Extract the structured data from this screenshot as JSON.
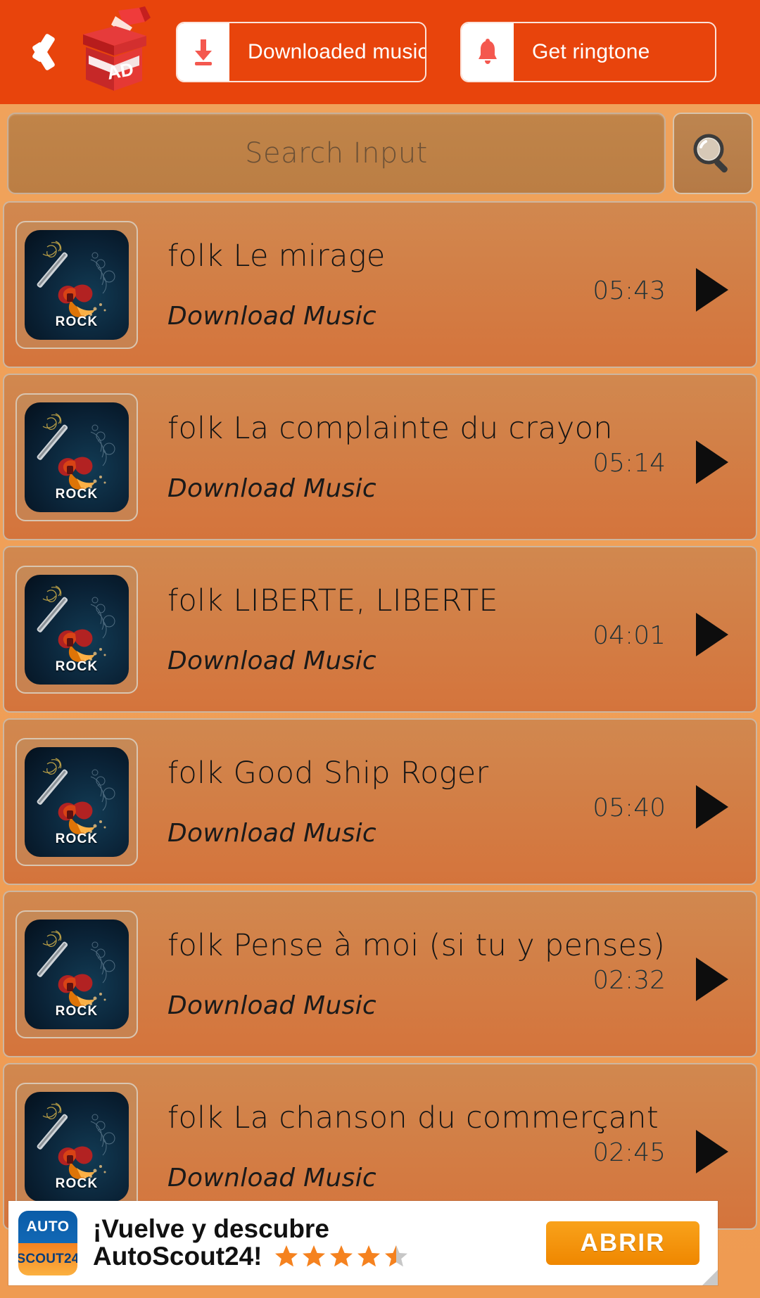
{
  "header": {
    "back_icon": "back-chevron-icon",
    "ad_badge_label": "AD",
    "downloaded_button": {
      "label": "Downloaded music",
      "icon": "download-icon"
    },
    "ringtone_button": {
      "label": "Get ringtone",
      "icon": "bell-icon"
    },
    "background_color": "#e8440c"
  },
  "search": {
    "placeholder": "Search Input",
    "value": "",
    "button_icon": "magnifier-icon"
  },
  "list": {
    "subtitle_label": "Download Music",
    "badge_label": "ROCK",
    "play_icon": "play-icon",
    "tracks": [
      {
        "title": "folk Le mirage",
        "subtitle": "Download Music",
        "duration": "05:43",
        "badge": "ROCK"
      },
      {
        "title": "folk La complainte du crayon",
        "subtitle": "Download Music",
        "duration": "05:14",
        "badge": "ROCK"
      },
      {
        "title": "folk LIBERTE, LIBERTE",
        "subtitle": "Download Music",
        "duration": "04:01",
        "badge": "ROCK"
      },
      {
        "title": "folk Good Ship Roger",
        "subtitle": "Download Music",
        "duration": "05:40",
        "badge": "ROCK"
      },
      {
        "title": "folk Pense à moi (si tu y penses)",
        "subtitle": "Download Music",
        "duration": "02:32",
        "badge": "ROCK"
      },
      {
        "title": "folk La chanson du commerçant",
        "subtitle": "Download Music",
        "duration": "02:45",
        "badge": "ROCK"
      }
    ]
  },
  "ad": {
    "logo_top": "AUTO",
    "logo_bottom": "SCOUT24",
    "headline_line1": "¡Vuelve y descubre",
    "headline_line2": "AutoScout24!",
    "rating": 4.5,
    "stars_total": 5,
    "cta_label": "ABRIR",
    "cta_color": "#f39200"
  }
}
